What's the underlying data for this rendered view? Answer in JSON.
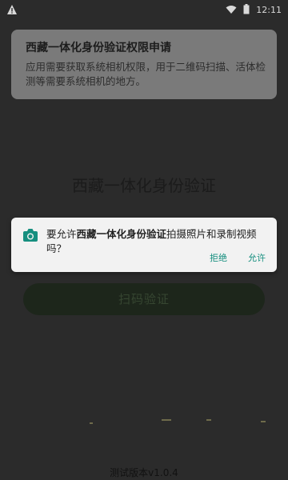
{
  "status_bar": {
    "time": "12:11"
  },
  "permission_notice": {
    "title": "西藏一体化身份验证权限申请",
    "body": "应用需要获取系统相机权限，用于二维码扫描、活体检测等需要系统相机的地方。"
  },
  "page": {
    "title": "西藏一体化身份验证"
  },
  "dialog": {
    "message_prefix": "要允许",
    "app_name": "西藏一体化身份验证",
    "message_suffix": "拍摄照片和录制视频吗？",
    "deny_label": "拒绝",
    "allow_label": "允许"
  },
  "main_button": {
    "label": "扫码验证"
  },
  "footer": {
    "version": "测试版本v1.0.4"
  },
  "colors": {
    "dialog_accent": "#168f7f",
    "background": "#2b2b2b"
  }
}
